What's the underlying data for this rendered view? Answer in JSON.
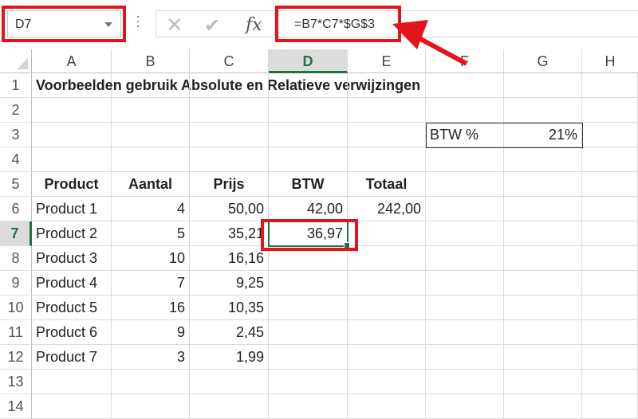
{
  "formula_bar": {
    "name_box": "D7",
    "cancel_icon": "x-icon",
    "enter_icon": "checkmark-icon",
    "function_icon": "fx-icon",
    "fx_label": "fx",
    "formula": "=B7*C7*$G$3"
  },
  "annotations": {
    "highlight_color": "#e3141b",
    "highlighted": [
      "name-box",
      "formula-input",
      "cell-D7"
    ],
    "arrow": "points to formula input"
  },
  "grid": {
    "columns": [
      "A",
      "B",
      "C",
      "D",
      "E",
      "F",
      "G",
      "H"
    ],
    "selected_column": "D",
    "rows": [
      "1",
      "2",
      "3",
      "4",
      "5",
      "6",
      "7",
      "8",
      "9",
      "10",
      "11",
      "12",
      "13",
      "14"
    ],
    "selected_row": "7",
    "selection_color": "#217346",
    "title": "Voorbeelden gebruik Absolute en Relatieve verwijzingen",
    "vat_label": "BTW %",
    "vat_value": "21%",
    "headers": [
      "Product",
      "Aantal",
      "Prijs",
      "BTW",
      "Totaal"
    ],
    "products": [
      {
        "name": "Product 1",
        "aantal": "4",
        "prijs": "50,00",
        "btw": "42,00",
        "totaal": "242,00"
      },
      {
        "name": "Product 2",
        "aantal": "5",
        "prijs": "35,21",
        "btw": "36,97",
        "totaal": ""
      },
      {
        "name": "Product 3",
        "aantal": "10",
        "prijs": "16,16",
        "btw": "",
        "totaal": ""
      },
      {
        "name": "Product 4",
        "aantal": "7",
        "prijs": "9,25",
        "btw": "",
        "totaal": ""
      },
      {
        "name": "Product 5",
        "aantal": "16",
        "prijs": "10,35",
        "btw": "",
        "totaal": ""
      },
      {
        "name": "Product 6",
        "aantal": "9",
        "prijs": "2,45",
        "btw": "",
        "totaal": ""
      },
      {
        "name": "Product 7",
        "aantal": "3",
        "prijs": "1,99",
        "btw": "",
        "totaal": ""
      }
    ]
  }
}
